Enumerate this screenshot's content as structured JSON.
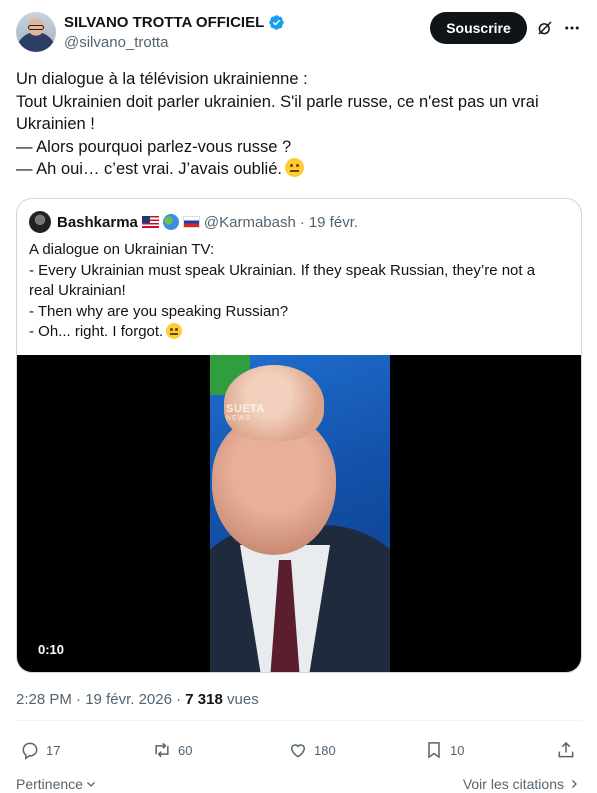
{
  "author": {
    "display_name": "SILVANO TROTTA OFFICIEL",
    "handle": "@silvano_trotta",
    "verified": true
  },
  "subscribe_label": "Souscrire",
  "tweet": {
    "lines": [
      "Un dialogue à la télévision ukrainienne :",
      "Tout Ukrainien doit parler ukrainien. S'il parle russe, ce n'est pas un vrai",
      "Ukrainien !",
      "— Alors pourquoi parlez-vous russe ?",
      "— Ah oui… c’est vrai. J’avais oublié."
    ]
  },
  "quote": {
    "name": "Bashkarma",
    "handle": "@Karmabash",
    "date": "19 févr.",
    "lines": [
      "A dialogue on Ukrainian TV:",
      "- Every Ukrainian must speak Ukrainian. If they speak Russian, they’re not a",
      "real Ukrainian!",
      "- Then why are you speaking Russian?",
      "- Oh... right. I forgot."
    ],
    "video": {
      "duration": "0:10",
      "watermark_top": "SUETA",
      "watermark_bottom": "NEWS"
    }
  },
  "meta": {
    "time": "2:28 PM",
    "date": "19 févr. 2026",
    "separator": "·",
    "views_count": "7 318",
    "views_label": "vues"
  },
  "actions": {
    "replies": "17",
    "reposts": "60",
    "likes": "180",
    "bookmarks": "10"
  },
  "footer": {
    "sort_label": "Pertinence",
    "view_quotes_label": "Voir les citations"
  },
  "colors": {
    "text": "#0f1419",
    "secondary": "#536471",
    "verified": "#1d9bf0",
    "border": "#cfd9de"
  },
  "icons": [
    "verified-badge-icon",
    "grok-icon",
    "more-icon",
    "reply-icon",
    "repost-icon",
    "like-icon",
    "bookmark-icon",
    "share-icon",
    "chevron-down-icon",
    "chevron-right-icon"
  ]
}
